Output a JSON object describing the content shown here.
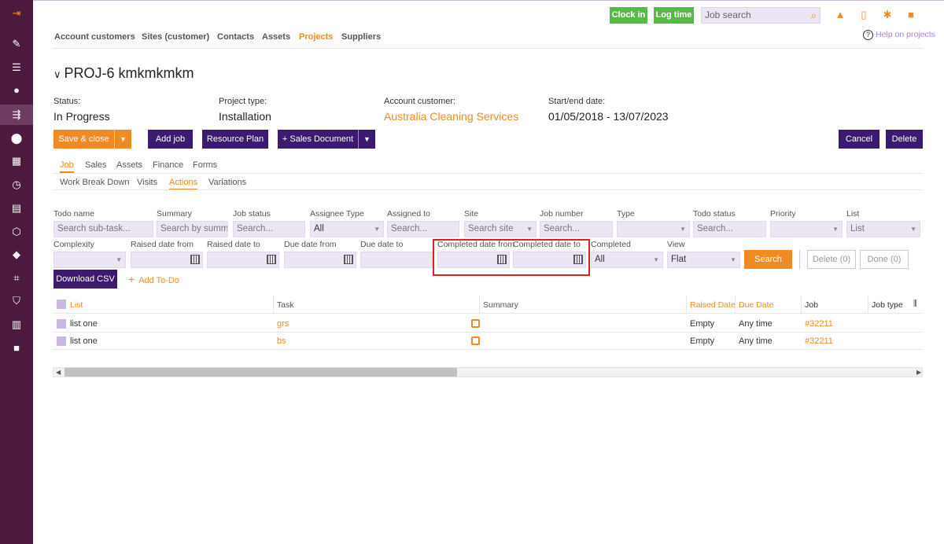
{
  "header": {
    "clock_in": "Clock in",
    "log_time": "Log time",
    "job_search_placeholder": "Job search",
    "help_prefix": "?",
    "help_label": "Help on projects"
  },
  "nav": [
    "Account customers",
    "Sites (customer)",
    "Contacts",
    "Assets",
    "Projects",
    "Suppliers"
  ],
  "project": {
    "title": "PROJ-6 kmkmkmkm",
    "status_label": "Status:",
    "status_value": "In Progress",
    "type_label": "Project type:",
    "type_value": "Installation",
    "customer_label": "Account customer:",
    "customer_value": "Australia Cleaning Services",
    "dates_label": "Start/end date:",
    "dates_value": "01/05/2018 - 13/07/2023"
  },
  "actions": {
    "save_close": "Save & close",
    "add_job": "Add job",
    "resource_plan": "Resource Plan",
    "sales_document": "+ Sales Document",
    "cancel": "Cancel",
    "delete": "Delete"
  },
  "tabs": [
    "Job",
    "Sales",
    "Assets",
    "Finance",
    "Forms"
  ],
  "subtabs": [
    "Work Break Down",
    "Visits",
    "Actions",
    "Variations"
  ],
  "filters": {
    "todo_name": {
      "label": "Todo name",
      "placeholder": "Search sub-task..."
    },
    "summary": {
      "label": "Summary",
      "placeholder": "Search by summa"
    },
    "job_status": {
      "label": "Job status",
      "placeholder": "Search..."
    },
    "assignee_type": {
      "label": "Assignee Type",
      "value": "All"
    },
    "assigned_to": {
      "label": "Assigned to",
      "placeholder": "Search..."
    },
    "site": {
      "label": "Site",
      "placeholder": "Search site"
    },
    "job_number": {
      "label": "Job number",
      "placeholder": "Search..."
    },
    "type": {
      "label": "Type",
      "value": ""
    },
    "todo_status": {
      "label": "Todo status",
      "placeholder": "Search..."
    },
    "priority": {
      "label": "Priority",
      "value": ""
    },
    "list": {
      "label": "List",
      "value": "List"
    },
    "complexity": {
      "label": "Complexity",
      "value": ""
    },
    "raised_from": {
      "label": "Raised date from"
    },
    "raised_to": {
      "label": "Raised date to"
    },
    "due_from": {
      "label": "Due date from"
    },
    "due_to": {
      "label": "Due date to"
    },
    "completed_from": {
      "label": "Completed date from"
    },
    "completed_to": {
      "label": "Completed date to"
    },
    "completed": {
      "label": "Completed",
      "value": "All"
    },
    "view": {
      "label": "View",
      "value": "Flat"
    },
    "search_button": "Search",
    "delete_button": "Delete (0)",
    "done_button": "Done (0)",
    "download_csv": "Download CSV",
    "add_todo": "Add To-Do"
  },
  "table": {
    "columns": [
      "List",
      "Task",
      "Summary",
      "Raised Date",
      "Due Date",
      "Job",
      "Job type"
    ],
    "rows": [
      {
        "list": "list one",
        "task": "grs",
        "raised": "Empty",
        "due": "Any time",
        "job": "#32211"
      },
      {
        "list": "list one",
        "task": "bs",
        "raised": "Empty",
        "due": "Any time",
        "job": "#32211"
      }
    ]
  },
  "colors": {
    "orange": "#f08a24",
    "purple": "#3c1a6e",
    "green": "#58b947",
    "sidebar": "#4b1a3e"
  }
}
